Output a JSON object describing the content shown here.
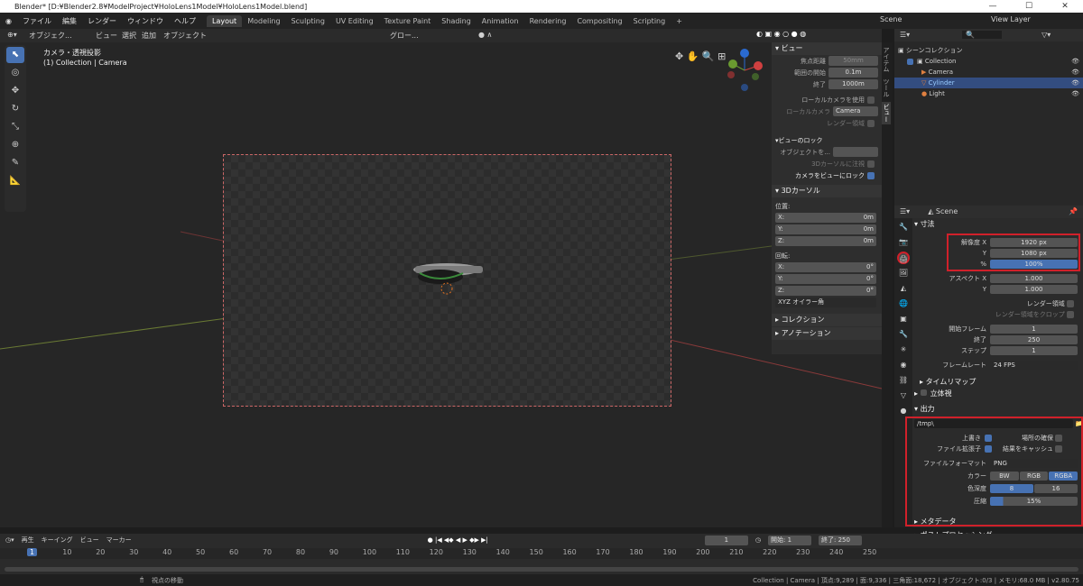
{
  "title": "Blender* [D:¥Blender2.8¥ModelProject¥HoloLens1Model¥HoloLens1Model.blend]",
  "menu": [
    "ファイル",
    "編集",
    "レンダー",
    "ウィンドウ",
    "ヘルプ"
  ],
  "tabs": [
    "Layout",
    "Modeling",
    "Sculpting",
    "UV Editing",
    "Texture Paint",
    "Shading",
    "Animation",
    "Rendering",
    "Compositing",
    "Scripting"
  ],
  "scene_label": "Scene",
  "view_layer": "View Layer",
  "header3d": {
    "mode": "オブジェク...",
    "view": "ビュー",
    "select": "選択",
    "add": "追加",
    "object": "オブジェクト",
    "orient": "グロー..."
  },
  "viewport": {
    "line1": "カメラ・透視投影",
    "line2": "(1) Collection | Camera"
  },
  "npanel": {
    "view_title": "ビュー",
    "focal_label": "焦点距離",
    "focal": "50mm",
    "clip_start_label": "範囲の開始",
    "clip_start": "0.1m",
    "clip_end_label": "終了",
    "clip_end": "1000m",
    "local_cam": "ローカルカメラを使用",
    "local_cam_label": "ローカルカメラ",
    "camera": "Camera",
    "render_region": "レンダー領域",
    "lock_title": "ビューのロック",
    "lock_obj": "オブジェクトを...",
    "lock_cursor": "3Dカーソルに注視",
    "lock_cam": "カメラをビューにロック",
    "cursor_title": "3Dカーソル",
    "pos_label": "位置:",
    "x": "X:",
    "y": "Y:",
    "z": "Z:",
    "zero": "0m",
    "rot_label": "回転:",
    "deg": "0°",
    "euler": "XYZ オイラー角",
    "collection": "コレクション",
    "annotation": "アノテーション"
  },
  "sidetabs": [
    "アイテム",
    "ツール",
    "ビュー"
  ],
  "outliner": {
    "root": "シーンコレクション",
    "collection": "Collection",
    "items": [
      "Camera",
      "Cylinder",
      "Light"
    ]
  },
  "props": {
    "scene": "Scene",
    "dimensions": "寸法",
    "resx_label": "解像度 X",
    "resx": "1920 px",
    "resy_label": "Y",
    "resy": "1080 px",
    "pct_label": "%",
    "pct": "100%",
    "aspx_label": "アスペクト X",
    "aspx": "1.000",
    "aspy_label": "Y",
    "aspy": "1.000",
    "render_region": "レンダー領域",
    "crop": "レンダー領域をクロップ",
    "fstart_label": "開始フレーム",
    "fstart": "1",
    "fend_label": "終了",
    "fend": "250",
    "fstep_label": "ステップ",
    "fstep": "1",
    "fps_label": "フレームレート",
    "fps": "24 FPS",
    "time_remap": "タイムリマップ",
    "stereo": "立体視",
    "output": "出力",
    "path": "/tmp\\",
    "overwrite": "上書き",
    "placeholders": "場所の確保",
    "file_ext": "ファイル拡張子",
    "cache": "結果をキャッシュ",
    "format_label": "ファイルフォーマット",
    "format": "PNG",
    "color_label": "カラー",
    "bw": "BW",
    "rgb": "RGB",
    "rgba": "RGBA",
    "depth_label": "色深度",
    "d8": "8",
    "d16": "16",
    "comp_label": "圧縮",
    "comp": "15%",
    "metadata": "メタデータ",
    "post": "ポストプロセッシング"
  },
  "timeline": {
    "play": "再生",
    "keying": "キーイング",
    "view": "ビュー",
    "marker": "マーカー",
    "current": "1",
    "start_label": "開始:",
    "start": "1",
    "end_label": "終了:",
    "end": "250",
    "ticks": [
      "1",
      "10",
      "20",
      "30",
      "40",
      "50",
      "60",
      "70",
      "80",
      "90",
      "100",
      "110",
      "120",
      "130",
      "140",
      "150",
      "160",
      "170",
      "180",
      "190",
      "200",
      "210",
      "220",
      "230",
      "240",
      "250"
    ]
  },
  "status": {
    "left": "視点の移動",
    "right": "Collection | Camera | 頂点:9,289 | 面:9,336 | 三角面:18,672 | オブジェクト:0/3 | メモリ:68.0 MB | v2.80.75"
  }
}
